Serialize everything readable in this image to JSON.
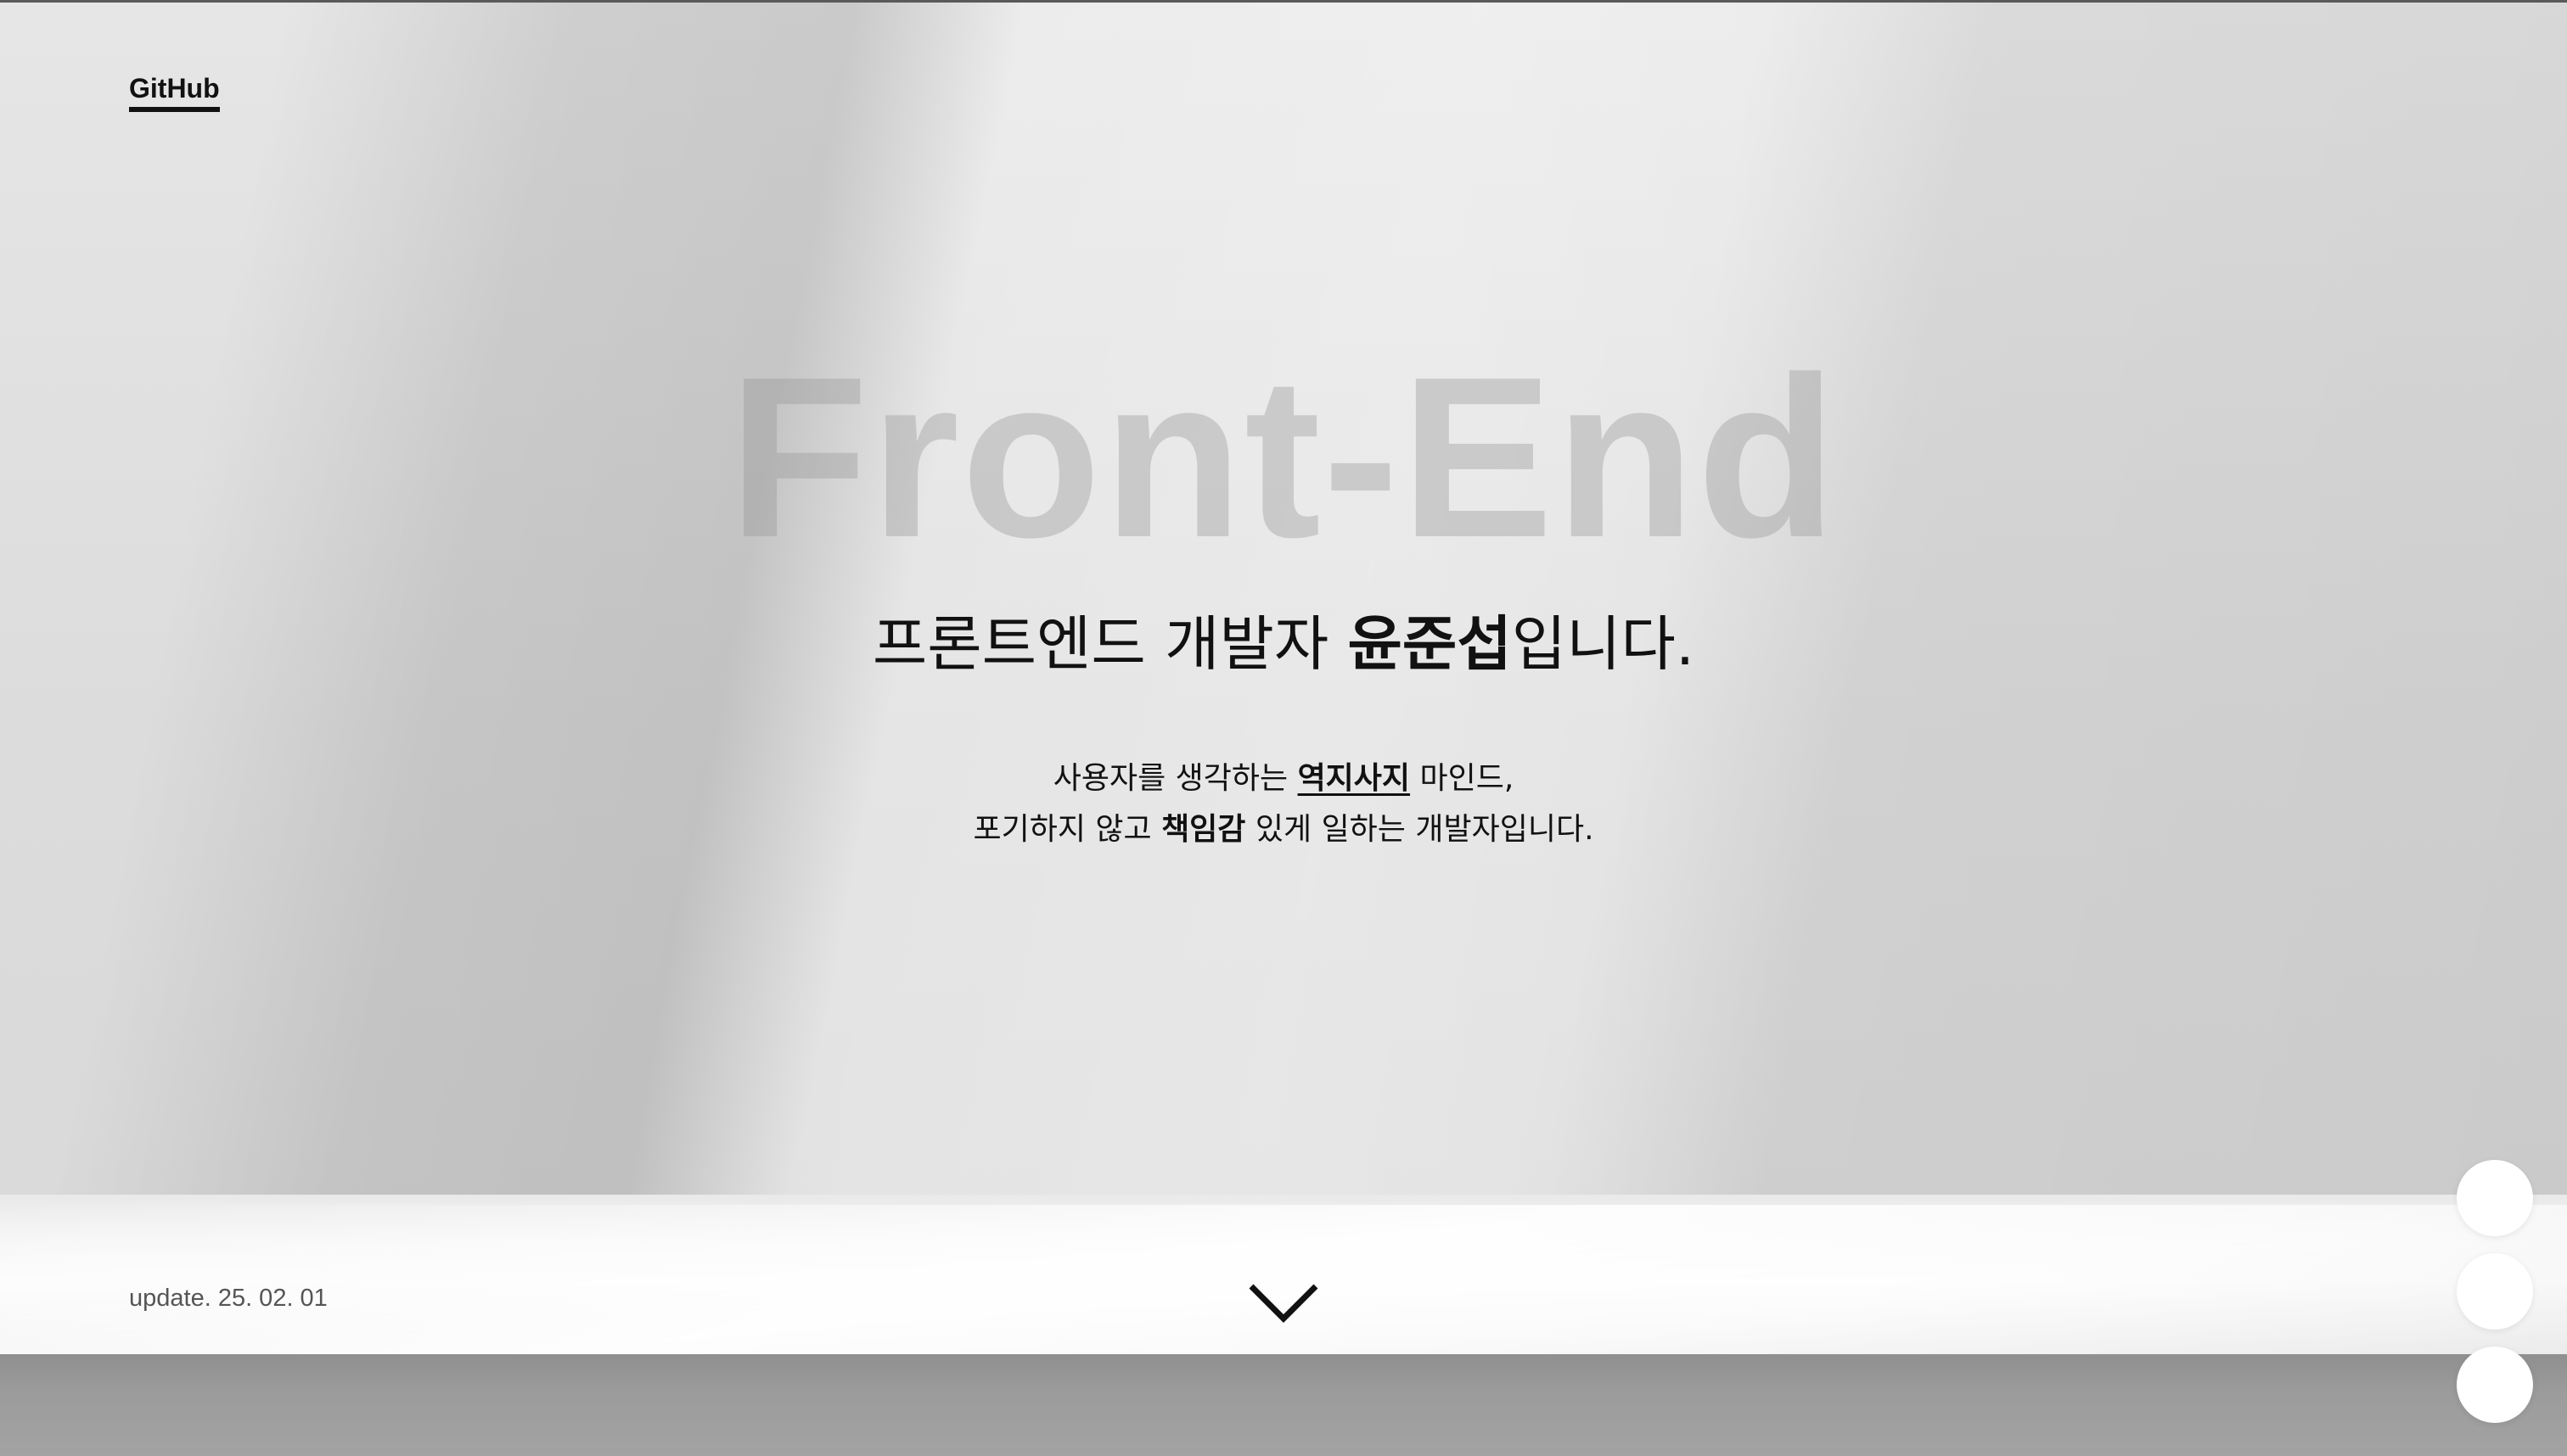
{
  "nav": {
    "github_label": "GitHub"
  },
  "hero": {
    "background_word": "Front-End",
    "headline_prefix": "프론트엔드 개발자 ",
    "headline_name": "윤준섭",
    "headline_suffix": "입니다.",
    "line1_prefix": "사용자를 생각하는 ",
    "line1_emphasis": "역지사지",
    "line1_suffix": " 마인드,",
    "line2_prefix": "포기하지 않고 ",
    "line2_emphasis": "책임감",
    "line2_suffix": " 있게 일하는 개발자입니다."
  },
  "footer": {
    "update_text": "update. 25. 02. 01",
    "scroll_icon": "chevron-down-icon"
  },
  "side_nav": {
    "dots": [
      "section-1",
      "section-2",
      "section-3"
    ]
  },
  "colors": {
    "text": "#111111",
    "background_word": "#969696",
    "dot": "#ffffff"
  }
}
